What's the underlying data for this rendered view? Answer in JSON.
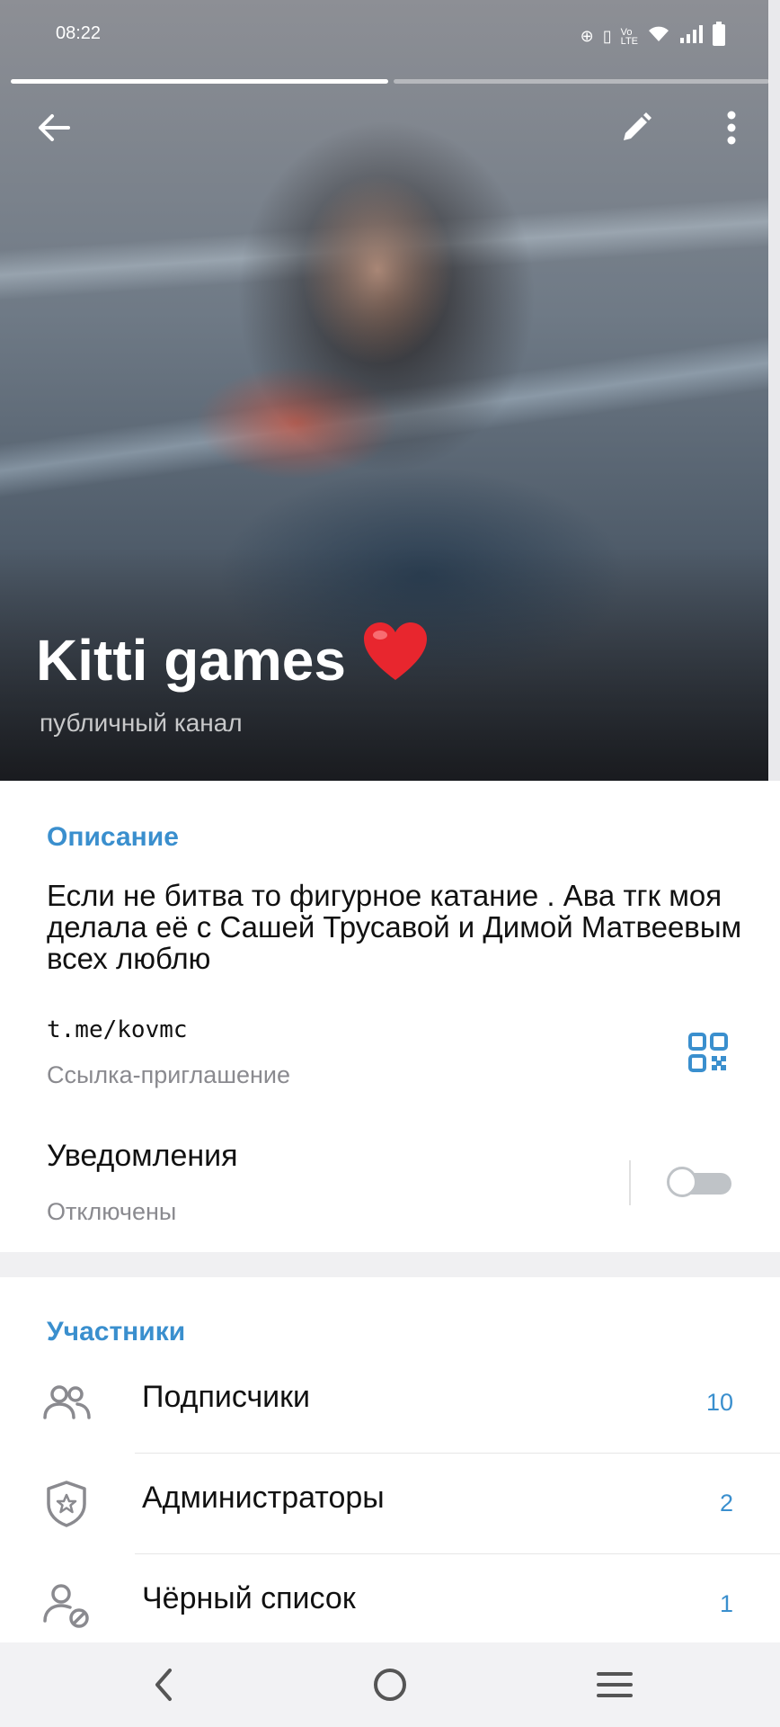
{
  "status_bar": {
    "time": "08:22"
  },
  "story_progress": 0.5,
  "channel": {
    "title": "Kitti games",
    "emoji": "❤️",
    "subtitle": "публичный канал"
  },
  "info": {
    "description_title": "Описание",
    "description": "Если не битва то фигурное катание . Ава тгк моя делала её с Сашей Трусавой и Димой Матвеевым всех люблю",
    "link": "t.me/kovmc",
    "link_caption": "Ссылка-приглашение",
    "notifications_label": "Уведомления",
    "notifications_status": "Отключены",
    "notifications_enabled": false
  },
  "members": {
    "section_title": "Участники",
    "rows": [
      {
        "label": "Подписчики",
        "count": "10",
        "icon": "subscribers-icon"
      },
      {
        "label": "Администраторы",
        "count": "2",
        "icon": "admin-shield-icon"
      },
      {
        "label": "Чёрный список",
        "count": "1",
        "icon": "blacklist-icon"
      }
    ]
  },
  "colors": {
    "accent": "#3a8fce",
    "text": "#111111",
    "secondary": "#8a8a8f"
  }
}
